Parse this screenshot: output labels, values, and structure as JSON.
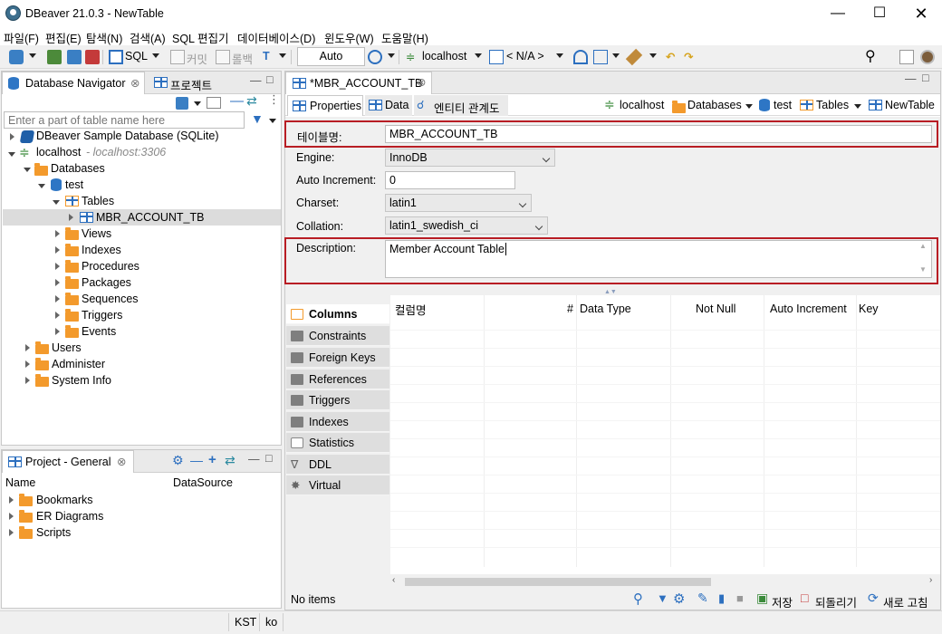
{
  "window": {
    "title": "DBeaver 21.0.3 - NewTable"
  },
  "menu": [
    "파일(F)",
    "편집(E)",
    "탐색(N)",
    "검색(A)",
    "SQL 편집기",
    "데이터베이스(D)",
    "윈도우(W)",
    "도움말(H)"
  ],
  "toolbar": {
    "sql": "SQL",
    "commit": "커밋",
    "rollback": "롤백",
    "auto": "Auto",
    "connection": "localhost",
    "schema": "< N/A >"
  },
  "navigator": {
    "tab": "Database Navigator",
    "tab2": "프로젝트",
    "filter_placeholder": "Enter a part of table name here",
    "tree": {
      "sample": "DBeaver Sample Database (SQLite)",
      "localhost": "localhost",
      "localhost_host": " - localhost:3306",
      "databases": "Databases",
      "test": "test",
      "tables": "Tables",
      "table": "MBR_ACCOUNT_TB",
      "folders": [
        "Views",
        "Indexes",
        "Procedures",
        "Packages",
        "Sequences",
        "Triggers",
        "Events"
      ],
      "users": "Users",
      "administer": "Administer",
      "system_info": "System Info"
    }
  },
  "project": {
    "tab": "Project - General",
    "col_name": "Name",
    "col_ds": "DataSource",
    "items": [
      "Bookmarks",
      "ER Diagrams",
      "Scripts"
    ]
  },
  "editor": {
    "tab": "*MBR_ACCOUNT_TB",
    "subtabs": {
      "properties": "Properties",
      "data": "Data",
      "er": "엔티티 관계도"
    },
    "breadcrumb": {
      "conn": "localhost",
      "dbs": "Databases",
      "db": "test",
      "tables": "Tables",
      "table": "NewTable"
    },
    "form": {
      "table_name_label": "테이블명:",
      "table_name": "MBR_ACCOUNT_TB",
      "engine_label": "Engine:",
      "engine": "InnoDB",
      "auto_inc_label": "Auto Increment:",
      "auto_inc": "0",
      "charset_label": "Charset:",
      "charset": "latin1",
      "collation_label": "Collation:",
      "collation": "latin1_swedish_ci",
      "desc_label": "Description:",
      "desc": "Member Account Table"
    },
    "sidetabs": {
      "columns": "Columns",
      "constraints": "Constraints",
      "fk": "Foreign Keys",
      "refs": "References",
      "triggers": "Triggers",
      "indexes": "Indexes",
      "stats": "Statistics",
      "ddl": "DDL",
      "virtual": "Virtual"
    },
    "columns": {
      "name": "컬럼명",
      "num": "#",
      "type": "Data Type",
      "notnull": "Not Null",
      "autoinc": "Auto Increment",
      "key": "Key"
    },
    "footer": {
      "no_items": "No items",
      "save": "저장",
      "revert": "되돌리기",
      "refresh": "새로 고침"
    }
  },
  "status": {
    "tz": "KST",
    "locale": "ko"
  },
  "colors": {
    "accent": "#2c6fbf",
    "folder": "#f39a2c",
    "highlight": "#b81d24"
  }
}
